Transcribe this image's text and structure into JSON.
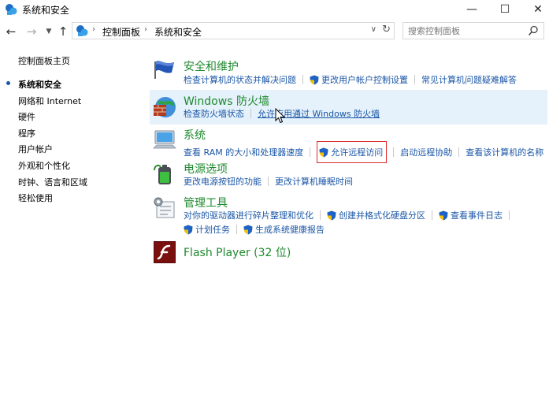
{
  "window": {
    "title": "系统和安全",
    "minimize": "—",
    "maximize": "☐",
    "close": "✕"
  },
  "address": {
    "crumbs": [
      "控制面板",
      "系统和安全"
    ],
    "search_placeholder": "搜索控制面板"
  },
  "sidebar": {
    "home": "控制面板主页",
    "items": [
      "系统和安全",
      "网络和 Internet",
      "硬件",
      "程序",
      "用户帐户",
      "外观和个性化",
      "时钟、语言和区域",
      "轻松使用"
    ],
    "active_index": 0
  },
  "categories": [
    {
      "title": "安全和维护",
      "icon": "security-flag-icon",
      "links": [
        {
          "text": "检查计算机的状态并解决问题",
          "shield": false
        },
        {
          "text": "更改用户帐户控制设置",
          "shield": true
        },
        {
          "text": "常见计算机问题疑难解答",
          "shield": false
        }
      ]
    },
    {
      "title": "Windows 防火墙",
      "icon": "firewall-icon",
      "highlighted": true,
      "links": [
        {
          "text": "检查防火墙状态",
          "shield": false
        },
        {
          "text": "允许应用通过 Windows 防火墙",
          "shield": false,
          "hovered": true
        }
      ]
    },
    {
      "title": "系统",
      "icon": "system-computer-icon",
      "links": [
        {
          "text": "查看 RAM 的大小和处理器速度",
          "shield": false
        },
        {
          "text": "允许远程访问",
          "shield": true,
          "boxed": true
        },
        {
          "text": "启动远程协助",
          "shield": false
        },
        {
          "text": "查看该计算机的名称",
          "shield": false
        }
      ]
    },
    {
      "title": "电源选项",
      "icon": "power-battery-icon",
      "links": [
        {
          "text": "更改电源按钮的功能",
          "shield": false
        },
        {
          "text": "更改计算机睡眠时间",
          "shield": false
        }
      ]
    },
    {
      "title": "管理工具",
      "icon": "admin-tools-icon",
      "links": [
        {
          "text": "对你的驱动器进行碎片整理和优化",
          "shield": false
        },
        {
          "text": "创建并格式化硬盘分区",
          "shield": true
        },
        {
          "text": "查看事件日志",
          "shield": true
        }
      ],
      "links2": [
        {
          "text": "计划任务",
          "shield": true
        },
        {
          "text": "生成系统健康报告",
          "shield": true
        }
      ]
    },
    {
      "title": "Flash Player (32 位)",
      "icon": "flash-player-icon",
      "links": []
    }
  ],
  "colors": {
    "link": "#1a56a6",
    "category_title": "#1e8a2e",
    "highlight_row": "#e5f1fb",
    "red_box": "#d92b2b"
  }
}
